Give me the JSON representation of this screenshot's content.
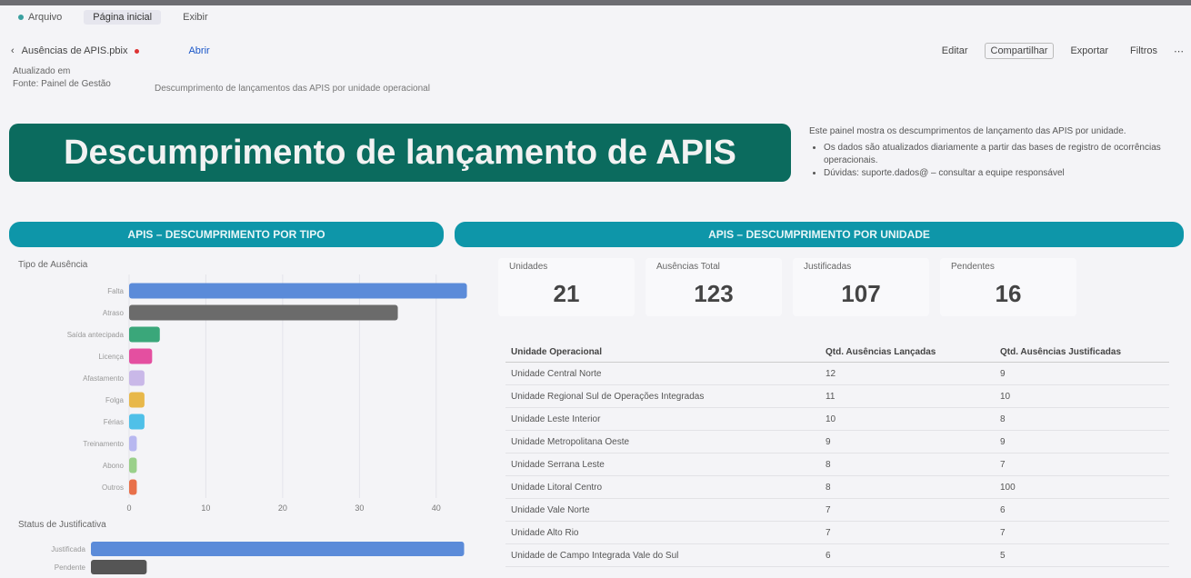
{
  "tabs": [
    {
      "label": "Arquivo",
      "active": false
    },
    {
      "label": "Página inicial",
      "active": true
    },
    {
      "label": "Exibir",
      "active": false
    }
  ],
  "file_bar": {
    "file_name": "Ausências de APIS.pbix",
    "open_button": "Abrir",
    "toolbar": [
      "Editar",
      "Compartilhar",
      "Exportar",
      "Filtros"
    ]
  },
  "info": {
    "line1": "Atualizado em",
    "line2": "Fonte: Painel de Gestão",
    "line3": "Descumprimento de lançamentos das APIS por unidade operacional"
  },
  "banner_title": "Descumprimento de lançamento de APIS",
  "notes": {
    "heading": "Este painel mostra os descumprimentos de lançamento das APIS por unidade.",
    "bullets": [
      "Os dados são atualizados diariamente a partir das bases de registro de ocorrências operacionais.",
      "Dúvidas: suporte.dados@ – consultar a equipe responsável"
    ]
  },
  "sections": {
    "left": "APIS – DESCUMPRIMENTO POR TIPO",
    "right": "APIS – DESCUMPRIMENTO POR UNIDADE"
  },
  "chart1": {
    "title": "Tipo de Ausência",
    "colors": [
      "#5b8bd9",
      "#6b6b6b",
      "#3aa77a",
      "#e44fa0",
      "#c9b8e8",
      "#e8b84a",
      "#4fc0e8",
      "#b8b8f0",
      "#9ad08a",
      "#e8704a"
    ]
  },
  "chart2": {
    "title": "Status de Justificativa",
    "colors": [
      "#5b8bd9",
      "#555555"
    ]
  },
  "kpis": [
    {
      "label": "Unidades",
      "value": "21"
    },
    {
      "label": "Ausências Total",
      "value": "123"
    },
    {
      "label": "Justificadas",
      "value": "107"
    },
    {
      "label": "Pendentes",
      "value": "16"
    }
  ],
  "table": {
    "headers": [
      "Unidade Operacional",
      "Qtd. Ausências Lançadas",
      "Qtd. Ausências Justificadas"
    ],
    "rows": [
      [
        "Unidade Central Norte",
        "12",
        "9"
      ],
      [
        "Unidade Regional Sul de Operações Integradas",
        "11",
        "10"
      ],
      [
        "Unidade Leste Interior",
        "10",
        "8"
      ],
      [
        "Unidade Metropolitana Oeste",
        "9",
        "9"
      ],
      [
        "Unidade Serrana Leste",
        "8",
        "7"
      ],
      [
        "Unidade Litoral Centro",
        "8",
        "100"
      ],
      [
        "Unidade Vale Norte",
        "7",
        "6"
      ],
      [
        "Unidade Alto Rio",
        "7",
        "7"
      ],
      [
        "Unidade de Campo Integrada Vale do Sul",
        "6",
        "5"
      ]
    ]
  },
  "chart_data": [
    {
      "type": "bar",
      "orientation": "horizontal",
      "title": "Tipo de Ausência",
      "categories": [
        "Falta",
        "Atraso",
        "Saída antecipada",
        "Licença",
        "Afastamento",
        "Folga",
        "Férias",
        "Treinamento",
        "Abono",
        "Outros"
      ],
      "values": [
        44,
        35,
        4,
        3,
        2,
        2,
        2,
        1,
        1,
        1
      ],
      "xlim": [
        0,
        45
      ],
      "xticks": [
        0,
        10,
        20,
        30,
        40
      ],
      "grid": true
    },
    {
      "type": "bar",
      "orientation": "horizontal",
      "title": "Status de Justificativa",
      "categories": [
        "Justificada",
        "Pendente"
      ],
      "values": [
        107,
        16
      ],
      "xlim": [
        0,
        110
      ]
    }
  ]
}
